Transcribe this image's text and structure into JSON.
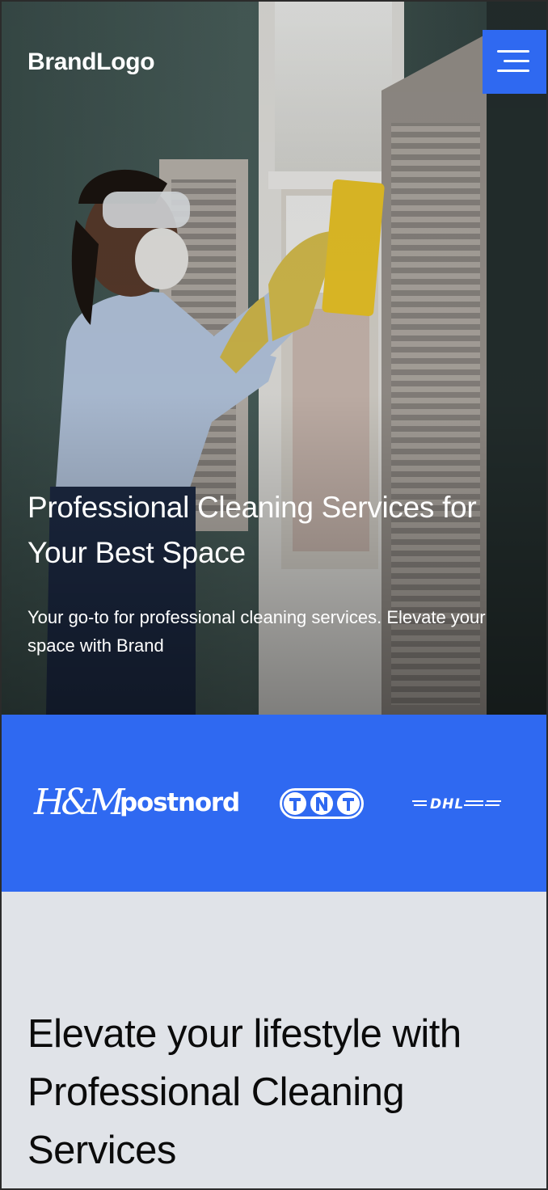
{
  "header": {
    "logo": "BrandLogo",
    "menu_icon": "hamburger-menu-icon"
  },
  "hero": {
    "title": "Professional Cleaning Services for Your Best Space",
    "subtitle": "Your go-to for professional cleaning services. Elevate your space with Brand",
    "image": "photo of a person in a mask, goggles and yellow gloves cleaning a window with a sponge"
  },
  "partners": {
    "background": "#2f69f1",
    "logos": [
      "H&M",
      "postnord",
      "TNT",
      "DHL"
    ]
  },
  "section": {
    "title": "Elevate your lifestyle with Professional Cleaning Services"
  },
  "colors": {
    "accent": "#2f69f1",
    "section_bg": "#e0e3e8"
  }
}
